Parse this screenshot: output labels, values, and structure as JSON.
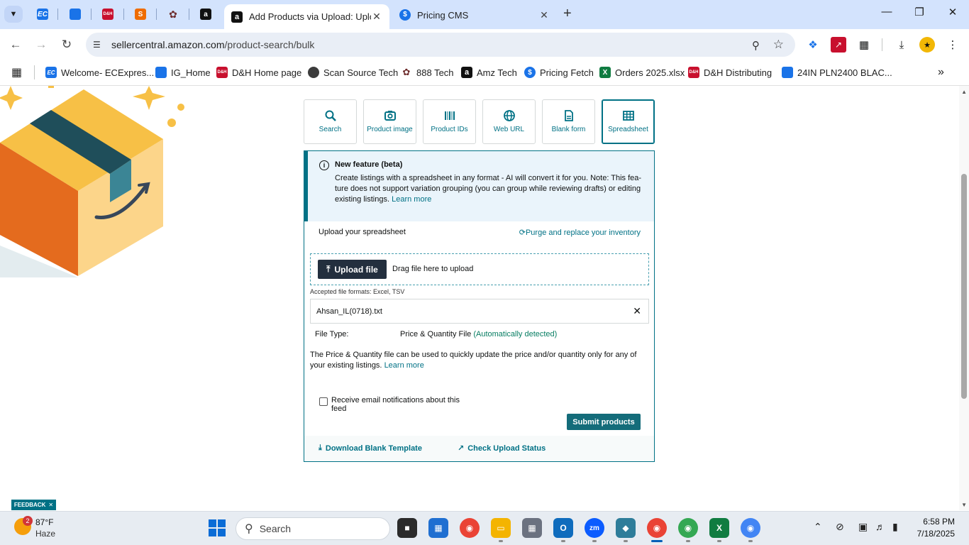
{
  "browser": {
    "tabs": [
      {
        "title": "Add Products via Upload: Uplo",
        "active": true
      },
      {
        "title": "Pricing CMS",
        "active": false
      }
    ],
    "pinned_tabs": [
      {
        "name": "ec",
        "label": "EC",
        "color": "#1a73e8"
      },
      {
        "name": "cloud-tab",
        "label": "",
        "color": "#1a73e8"
      },
      {
        "name": "dh-tab",
        "label": "D&H",
        "color": "#c8102e"
      },
      {
        "name": "s-tab",
        "label": "S",
        "color": "#ef6c00"
      },
      {
        "name": "tech-tab",
        "label": "",
        "color": "#6d2b2b"
      },
      {
        "name": "amazon-tab",
        "label": "a",
        "color": "#111111"
      }
    ],
    "url_host": "sellercentral.amazon.com",
    "url_path": "/product-search/bulk",
    "bookmarks": [
      {
        "label": "Welcome- ECExpres...",
        "icon": "EC",
        "color": "#1a73e8"
      },
      {
        "label": "IG_Home",
        "icon": "",
        "color": "#1a73e8"
      },
      {
        "label": "D&H Home page",
        "icon": "D&H",
        "color": "#c8102e"
      },
      {
        "label": "Scan Source Tech",
        "icon": "",
        "color": "#3c3c3c"
      },
      {
        "label": "888 Tech",
        "icon": "",
        "color": "#6d2b2b"
      },
      {
        "label": "Amz Tech",
        "icon": "a",
        "color": "#111111"
      },
      {
        "label": "Pricing Fetch",
        "icon": "$",
        "color": "#1a73e8"
      },
      {
        "label": "Orders 2025.xlsx",
        "icon": "X",
        "color": "#107c41"
      },
      {
        "label": "D&H Distributing",
        "icon": "D&H",
        "color": "#c8102e"
      },
      {
        "label": "24IN PLN2400 BLAC...",
        "icon": "",
        "color": "#1a73e8"
      }
    ]
  },
  "methods": [
    {
      "label": "Search",
      "icon": "search-icon",
      "selected": false
    },
    {
      "label": "Product image",
      "icon": "camera-icon",
      "selected": false
    },
    {
      "label": "Product IDs",
      "icon": "barcode-icon",
      "selected": false
    },
    {
      "label": "Web URL",
      "icon": "globe-icon",
      "selected": false
    },
    {
      "label": "Blank form",
      "icon": "document-icon",
      "selected": false
    },
    {
      "label": "Spreadsheet",
      "icon": "grid-icon",
      "selected": true
    }
  ],
  "alert": {
    "title": "New feature (beta)",
    "body": "Create listings with a spreadsheet in any format - AI will convert it for you. Note: This fea- ture does not support variation grouping (you can group while reviewing drafts) or editing existing listings.",
    "link": "Learn more"
  },
  "upload": {
    "label": "Upload your spreadsheet",
    "purge_link": "Purge and replace your inventory",
    "button": "Upload file",
    "drag_text": "Drag file here to upload",
    "formats": "Accepted file formats: Excel, TSV",
    "file_name": "Ahsan_IL(0718).txt",
    "file_type_label": "File Type:",
    "file_type_value": "Price & Quantity File",
    "file_type_detected": "(Automatically detected)",
    "description": "The Price & Quantity file can be used to quickly update the price and/or quantity only for any of your existing listings.",
    "description_link": "Learn more",
    "email_checkbox_label": "Receive email notifications about this feed",
    "email_checked": false,
    "submit": "Submit products",
    "download_template": "Download Blank Template",
    "check_status": "Check Upload Status"
  },
  "feedback": "FEEDBACK",
  "taskbar": {
    "weather_temp": "87°F",
    "weather_cond": "Haze",
    "weather_badge": "2",
    "search_placeholder": "Search",
    "time": "6:58 PM",
    "date": "7/18/2025"
  }
}
